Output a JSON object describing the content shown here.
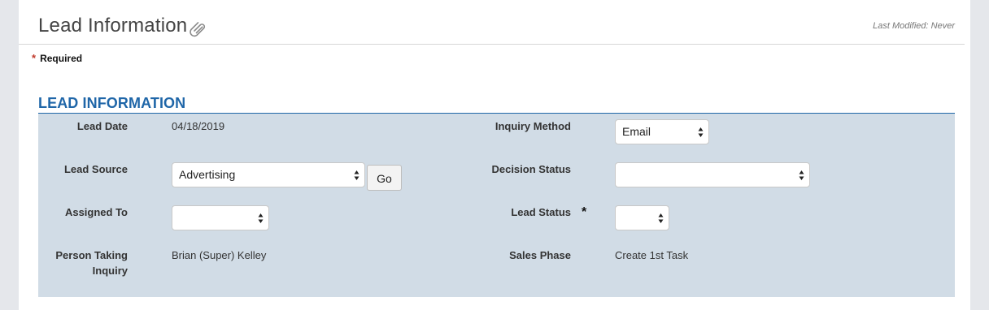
{
  "header": {
    "title": "Lead Information",
    "last_modified": "Last Modified: Never"
  },
  "required_note": {
    "star": "*",
    "label": "Required"
  },
  "section": {
    "title": "LEAD INFORMATION",
    "fields": {
      "lead_date": {
        "label": "Lead Date",
        "value": "04/18/2019"
      },
      "inquiry_method": {
        "label": "Inquiry Method",
        "value": "Email"
      },
      "lead_source": {
        "label": "Lead Source",
        "value": "Advertising",
        "go_label": "Go"
      },
      "decision_status": {
        "label": "Decision Status",
        "value": ""
      },
      "assigned_to": {
        "label": "Assigned To",
        "value": ""
      },
      "lead_status": {
        "label": "Lead Status",
        "value": "",
        "required_mark": "*"
      },
      "person_taking_inquiry": {
        "label_line1": "Person Taking",
        "label_line2": "Inquiry",
        "value": "Brian (Super) Kelley"
      },
      "sales_phase": {
        "label": "Sales Phase",
        "value": "Create 1st Task"
      }
    }
  },
  "colors": {
    "section_title": "#1f66a8",
    "form_background": "#d1dce6",
    "required_star": "#c0392b"
  },
  "icons": {
    "attachment": "paperclip-icon",
    "select_arrows": "select-arrows-icon"
  }
}
